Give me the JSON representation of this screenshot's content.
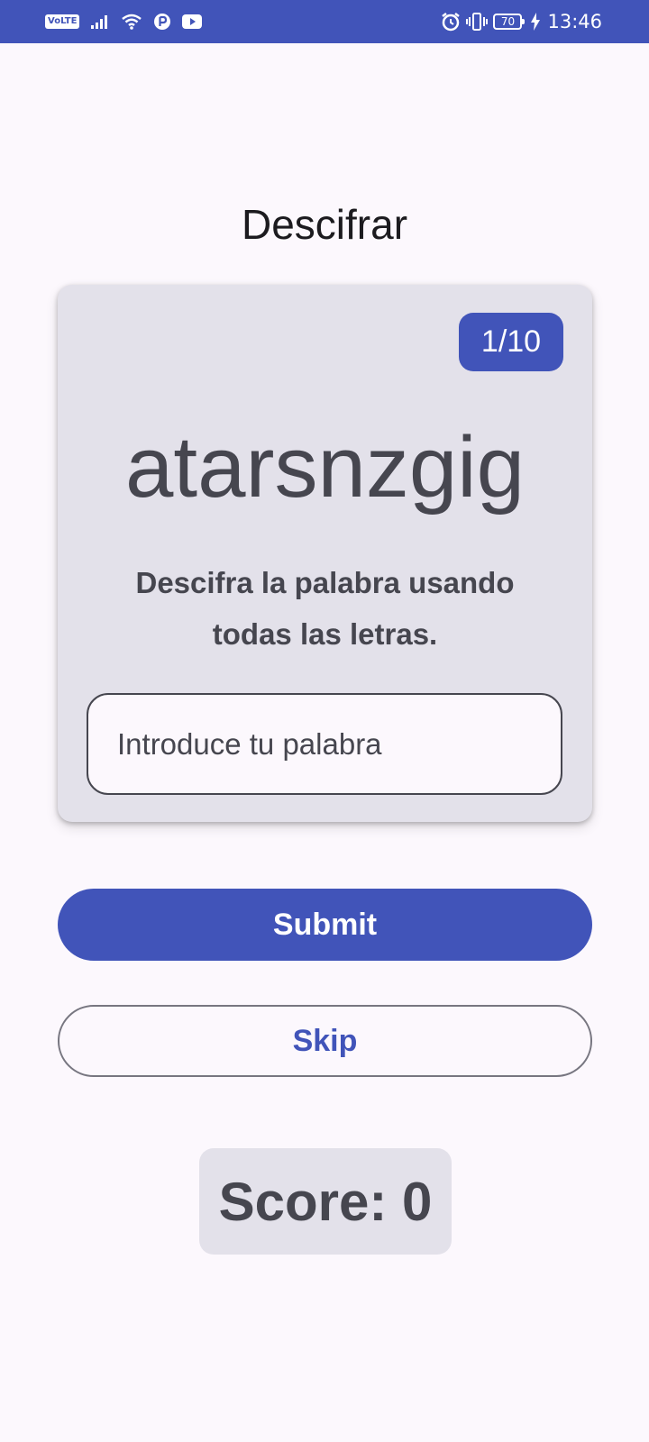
{
  "status_bar": {
    "network_badge": "VoLTE",
    "time": "13:46",
    "battery_level": "70",
    "icons": [
      "volte-icon",
      "signal-icon",
      "wifi-icon",
      "app-p-icon",
      "youtube-icon",
      "alarm-icon",
      "vibrate-icon",
      "battery-icon",
      "charging-icon"
    ]
  },
  "header": {
    "title": "Descifrar"
  },
  "game_card": {
    "word_count": "1/10",
    "scrambled_word": "atarsnzgig",
    "instructions": "Descifra la palabra usando todas las letras.",
    "input_placeholder": "Introduce tu palabra",
    "input_value": ""
  },
  "actions": {
    "submit_label": "Submit",
    "skip_label": "Skip"
  },
  "score": {
    "text": "Score: 0"
  },
  "colors": {
    "primary": "#4154b9",
    "background": "#fcf8fd",
    "card": "#e3e1ea",
    "on_surface_variant": "#46464f"
  }
}
